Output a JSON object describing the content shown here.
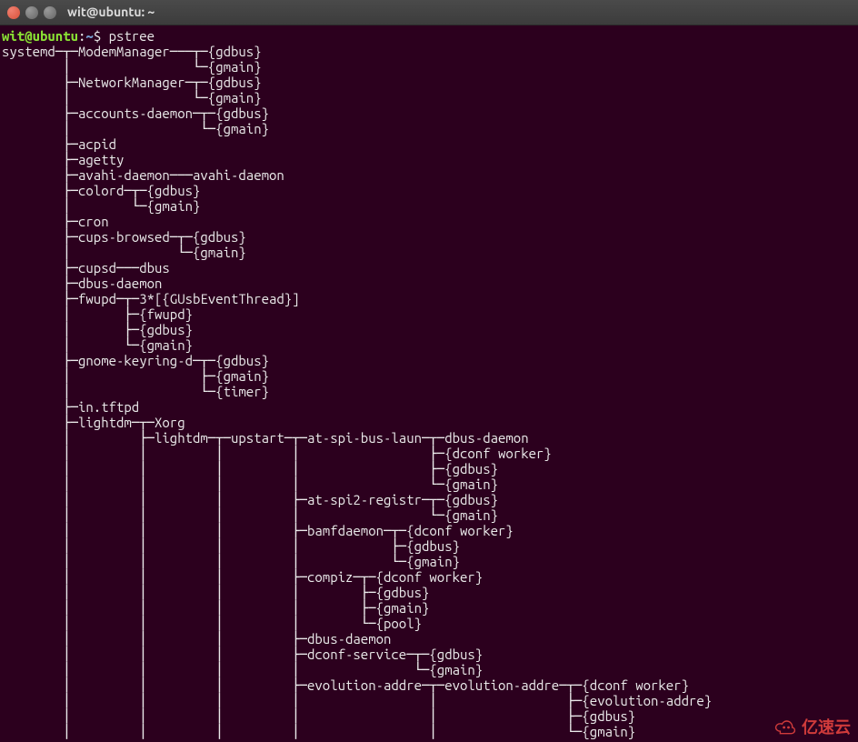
{
  "window": {
    "title": "wit@ubuntu: ~"
  },
  "prompt": {
    "user": "wit",
    "at": "@",
    "host": "ubuntu",
    "colon": ":",
    "path": "~",
    "sym": "$ ",
    "cmd": "pstree"
  },
  "lines": [
    "systemd─┬─ModemManager───┬─{gdbus}",
    "        │                └─{gmain}",
    "        ├─NetworkManager─┬─{gdbus}",
    "        │                └─{gmain}",
    "        ├─accounts-daemon─┬─{gdbus}",
    "        │                 └─{gmain}",
    "        ├─acpid",
    "        ├─agetty",
    "        ├─avahi-daemon───avahi-daemon",
    "        ├─colord─┬─{gdbus}",
    "        │        └─{gmain}",
    "        ├─cron",
    "        ├─cups-browsed─┬─{gdbus}",
    "        │              └─{gmain}",
    "        ├─cupsd───dbus",
    "        ├─dbus-daemon",
    "        ├─fwupd─┬─3*[{GUsbEventThread}]",
    "        │       ├─{fwupd}",
    "        │       ├─{gdbus}",
    "        │       └─{gmain}",
    "        ├─gnome-keyring-d─┬─{gdbus}",
    "        │                 ├─{gmain}",
    "        │                 └─{timer}",
    "        ├─in.tftpd",
    "        ├─lightdm─┬─Xorg",
    "        │         ├─lightdm─┬─upstart─┬─at-spi-bus-laun─┬─dbus-daemon",
    "        │         │         │         │                 ├─{dconf worker}",
    "        │         │         │         │                 ├─{gdbus}",
    "        │         │         │         │                 └─{gmain}",
    "        │         │         │         ├─at-spi2-registr─┬─{gdbus}",
    "        │         │         │         │                 └─{gmain}",
    "        │         │         │         ├─bamfdaemon─┬─{dconf worker}",
    "        │         │         │         │            ├─{gdbus}",
    "        │         │         │         │            └─{gmain}",
    "        │         │         │         ├─compiz─┬─{dconf worker}",
    "        │         │         │         │        ├─{gdbus}",
    "        │         │         │         │        ├─{gmain}",
    "        │         │         │         │        └─{pool}",
    "        │         │         │         ├─dbus-daemon",
    "        │         │         │         ├─dconf-service─┬─{gdbus}",
    "        │         │         │         │               └─{gmain}",
    "        │         │         │         ├─evolution-addre─┬─evolution-addre─┬─{dconf worker}",
    "        │         │         │         │                 │                 ├─{evolution-addre}",
    "        │         │         │         │                 │                 ├─{gdbus}",
    "        │         │         │         │                 │                 └─{gmain}"
  ],
  "watermark": {
    "text": "亿速云"
  }
}
